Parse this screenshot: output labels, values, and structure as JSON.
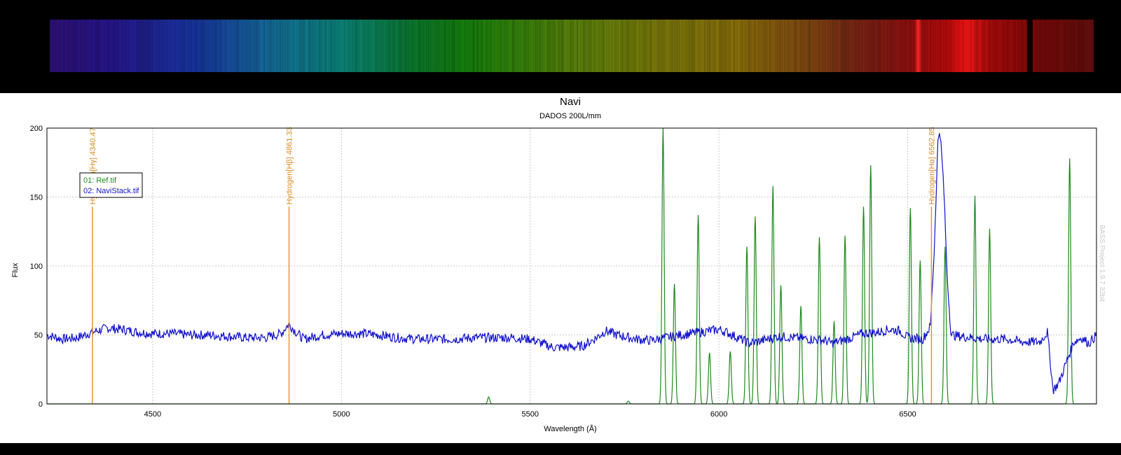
{
  "chart_data": {
    "type": "line",
    "title": "Navi",
    "subtitle": "DADOS 200L/mm",
    "xlabel": "Wavelength (Å)",
    "ylabel": "Flux",
    "xlim": [
      4220,
      7000
    ],
    "ylim": [
      0,
      200
    ],
    "xticks": [
      4500,
      5000,
      5500,
      6000,
      6500
    ],
    "yticks": [
      0,
      50,
      100,
      150,
      200
    ],
    "grid": true,
    "legend_position": "top-left",
    "watermark": "BASS Project 1.9.7 32bit",
    "markers": [
      {
        "label": "Hydrogen[Hγ] 4340.47",
        "wavelength": 4340.47,
        "color": "#e8962a"
      },
      {
        "label": "Hydrogen[Hβ] 4861.33",
        "wavelength": 4861.33,
        "color": "#e8962a"
      },
      {
        "label": "Hydrogen[Hα] 6562.85",
        "wavelength": 6562.85,
        "color": "#e8962a"
      }
    ],
    "series": [
      {
        "name": "01: Ref.tif",
        "color": "#1f8a1f",
        "baseline": 0,
        "peaks": [
          [
            5390,
            5
          ],
          [
            5760,
            2
          ],
          [
            5852,
            200
          ],
          [
            5882,
            87
          ],
          [
            5945,
            137
          ],
          [
            5975,
            37
          ],
          [
            6030,
            38
          ],
          [
            6074,
            114
          ],
          [
            6096,
            136
          ],
          [
            6143,
            158
          ],
          [
            6164,
            86
          ],
          [
            6217,
            71
          ],
          [
            6266,
            121
          ],
          [
            6305,
            60
          ],
          [
            6334,
            122
          ],
          [
            6383,
            143
          ],
          [
            6402,
            173
          ],
          [
            6507,
            142
          ],
          [
            6533,
            104
          ],
          [
            6599,
            114
          ],
          [
            6678,
            151
          ],
          [
            6717,
            127
          ],
          [
            6929,
            178
          ]
        ]
      },
      {
        "name": "02: NaviStack.tif",
        "color": "#1010cc",
        "points": [
          [
            4220,
            50
          ],
          [
            4260,
            47
          ],
          [
            4300,
            48
          ],
          [
            4340,
            52
          ],
          [
            4380,
            55
          ],
          [
            4420,
            54
          ],
          [
            4460,
            52
          ],
          [
            4500,
            51
          ],
          [
            4550,
            51
          ],
          [
            4600,
            50
          ],
          [
            4650,
            50
          ],
          [
            4700,
            49
          ],
          [
            4750,
            48
          ],
          [
            4800,
            48
          ],
          [
            4840,
            51
          ],
          [
            4861,
            58
          ],
          [
            4880,
            52
          ],
          [
            4900,
            47
          ],
          [
            4950,
            50
          ],
          [
            5000,
            51
          ],
          [
            5050,
            51
          ],
          [
            5100,
            50
          ],
          [
            5150,
            48
          ],
          [
            5200,
            47
          ],
          [
            5250,
            47
          ],
          [
            5300,
            47
          ],
          [
            5350,
            48
          ],
          [
            5400,
            48
          ],
          [
            5450,
            48
          ],
          [
            5500,
            47
          ],
          [
            5530,
            44
          ],
          [
            5560,
            41
          ],
          [
            5600,
            41
          ],
          [
            5640,
            42
          ],
          [
            5670,
            47
          ],
          [
            5700,
            53
          ],
          [
            5730,
            50
          ],
          [
            5780,
            47
          ],
          [
            5820,
            46
          ],
          [
            5860,
            48
          ],
          [
            5900,
            50
          ],
          [
            5950,
            52
          ],
          [
            6000,
            54
          ],
          [
            6020,
            52
          ],
          [
            6050,
            48
          ],
          [
            6080,
            44
          ],
          [
            6100,
            45
          ],
          [
            6130,
            47
          ],
          [
            6160,
            49
          ],
          [
            6200,
            48
          ],
          [
            6240,
            47
          ],
          [
            6280,
            46
          ],
          [
            6300,
            44
          ],
          [
            6340,
            47
          ],
          [
            6380,
            51
          ],
          [
            6420,
            52
          ],
          [
            6450,
            54
          ],
          [
            6480,
            53
          ],
          [
            6500,
            48
          ],
          [
            6540,
            47
          ],
          [
            6560,
            56
          ],
          [
            6570,
            110
          ],
          [
            6580,
            190
          ],
          [
            6585,
            200
          ],
          [
            6595,
            160
          ],
          [
            6605,
            90
          ],
          [
            6615,
            50
          ],
          [
            6640,
            49
          ],
          [
            6700,
            47
          ],
          [
            6760,
            47
          ],
          [
            6800,
            45
          ],
          [
            6850,
            45
          ],
          [
            6870,
            52
          ],
          [
            6885,
            10
          ],
          [
            6900,
            15
          ],
          [
            6920,
            30
          ],
          [
            6940,
            45
          ],
          [
            6960,
            48
          ],
          [
            6980,
            44
          ],
          [
            7000,
            50
          ]
        ]
      }
    ]
  }
}
